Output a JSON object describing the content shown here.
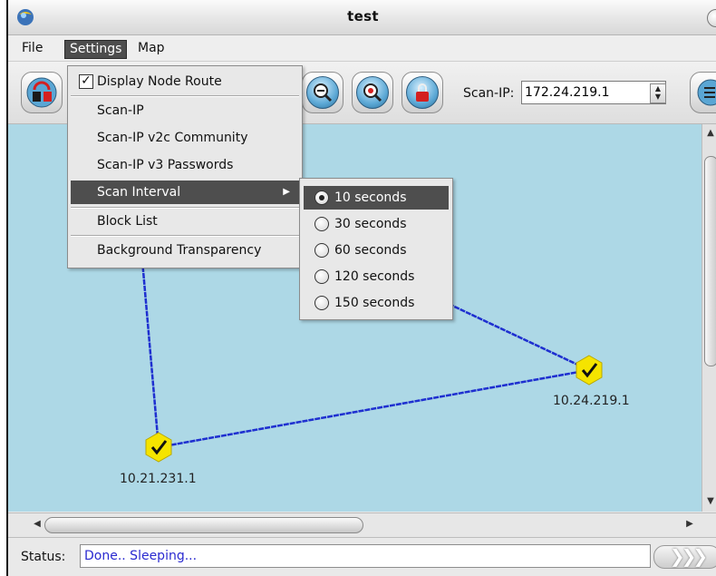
{
  "window": {
    "title": "test"
  },
  "menubar": {
    "items": [
      "File",
      "Settings",
      "Map"
    ],
    "active": "Settings"
  },
  "toolbar": {
    "scan_ip_label": "Scan-IP:",
    "scan_ip_value": "172.24.219.1",
    "buttons": [
      "disconnect-icon",
      "zoom-out-icon",
      "zoom-in-icon",
      "lock-icon",
      "menu-icon"
    ]
  },
  "settings_menu": {
    "display_node_route": {
      "label": "Display Node Route",
      "checked": true
    },
    "scan_ip": "Scan-IP",
    "scan_ip_v2c": "Scan-IP v2c Community",
    "scan_ip_v3": "Scan-IP v3 Passwords",
    "scan_interval": "Scan Interval",
    "block_list": "Block List",
    "background_transparency": "Background Transparency"
  },
  "scan_interval_submenu": {
    "options": [
      "10 seconds",
      "30 seconds",
      "60 seconds",
      "120 seconds",
      "150 seconds"
    ],
    "selected": "10 seconds"
  },
  "map": {
    "nodes": [
      {
        "label": "10.24.219.1",
        "status": "ok"
      },
      {
        "label": "10.21.231.1",
        "status": "ok"
      }
    ],
    "link_color": "#1e2fd0",
    "background": "#add8e6",
    "node_color": "#f5e400"
  },
  "status": {
    "label": "Status:",
    "text": "Done.. Sleeping..."
  }
}
